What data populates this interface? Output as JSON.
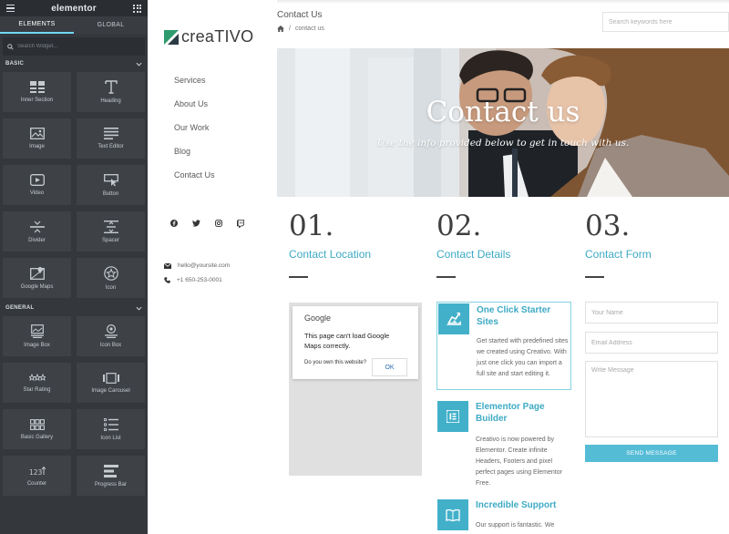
{
  "panel": {
    "brand": "elementor",
    "tabs": [
      {
        "label": "ELEMENTS"
      },
      {
        "label": "GLOBAL"
      }
    ],
    "search_placeholder": "Search Widget...",
    "categories": [
      {
        "label": "BASIC",
        "widgets": [
          {
            "label": "Inner Section",
            "icon": "inner-section-icon"
          },
          {
            "label": "Heading",
            "icon": "heading-icon"
          },
          {
            "label": "Image",
            "icon": "image-icon"
          },
          {
            "label": "Text Editor",
            "icon": "text-editor-icon"
          },
          {
            "label": "Video",
            "icon": "video-icon"
          },
          {
            "label": "Button",
            "icon": "button-icon"
          },
          {
            "label": "Divider",
            "icon": "divider-icon"
          },
          {
            "label": "Spacer",
            "icon": "spacer-icon"
          },
          {
            "label": "Google Maps",
            "icon": "google-maps-icon"
          },
          {
            "label": "Icon",
            "icon": "star-icon"
          }
        ]
      },
      {
        "label": "GENERAL",
        "widgets": [
          {
            "label": "Image Box",
            "icon": "image-box-icon"
          },
          {
            "label": "Icon Box",
            "icon": "icon-box-icon"
          },
          {
            "label": "Star Rating",
            "icon": "star-rating-icon"
          },
          {
            "label": "Image Carousel",
            "icon": "image-carousel-icon"
          },
          {
            "label": "Basic Gallery",
            "icon": "basic-gallery-icon"
          },
          {
            "label": "Icon List",
            "icon": "icon-list-icon"
          },
          {
            "label": "Counter",
            "icon": "counter-icon"
          },
          {
            "label": "Progress Bar",
            "icon": "progress-bar-icon"
          }
        ]
      }
    ],
    "accent_color": "#71d7f7"
  },
  "site": {
    "logo_text": "creaTIVO",
    "nav": [
      "Services",
      "About Us",
      "Our Work",
      "Blog",
      "Contact Us"
    ],
    "email": "hello@yoursite.com",
    "phone": "+1 650-253-0001"
  },
  "header": {
    "page_title": "Contact Us",
    "breadcrumb_current": "contact us",
    "search_placeholder": "Search keywords here"
  },
  "hero": {
    "title": "Contact us",
    "subtitle": "Use the info provided below to get in touch with us."
  },
  "columns": [
    {
      "num": "01.",
      "heading": "Contact Location"
    },
    {
      "num": "02.",
      "heading": "Contact Details"
    },
    {
      "num": "03.",
      "heading": "Contact Form"
    }
  ],
  "map": {
    "brand": "Google",
    "message": "This page can't load Google Maps correctly.",
    "question": "Do you own this website?",
    "ok_label": "OK"
  },
  "features": [
    {
      "title": "One Click Starter Sites",
      "text": "Get started with predefined sites we created using Creativo. With just one click you can import a full site and start editing it."
    },
    {
      "title": "Elementor Page Builder",
      "text": "Creativo is now powered by Elementor. Create infinite Headers, Footers and pixel perfect pages using Elementor Free."
    },
    {
      "title": "Incredible Support",
      "text": "Our support is fantastic. We"
    }
  ],
  "form": {
    "name_placeholder": "Your Name",
    "email_placeholder": "Email Address",
    "message_placeholder": "Write Message",
    "send_label": "SEND MESSAGE"
  },
  "colors": {
    "accent": "#3daac4",
    "button": "#55bcd6",
    "panel_bg": "#34383c"
  }
}
